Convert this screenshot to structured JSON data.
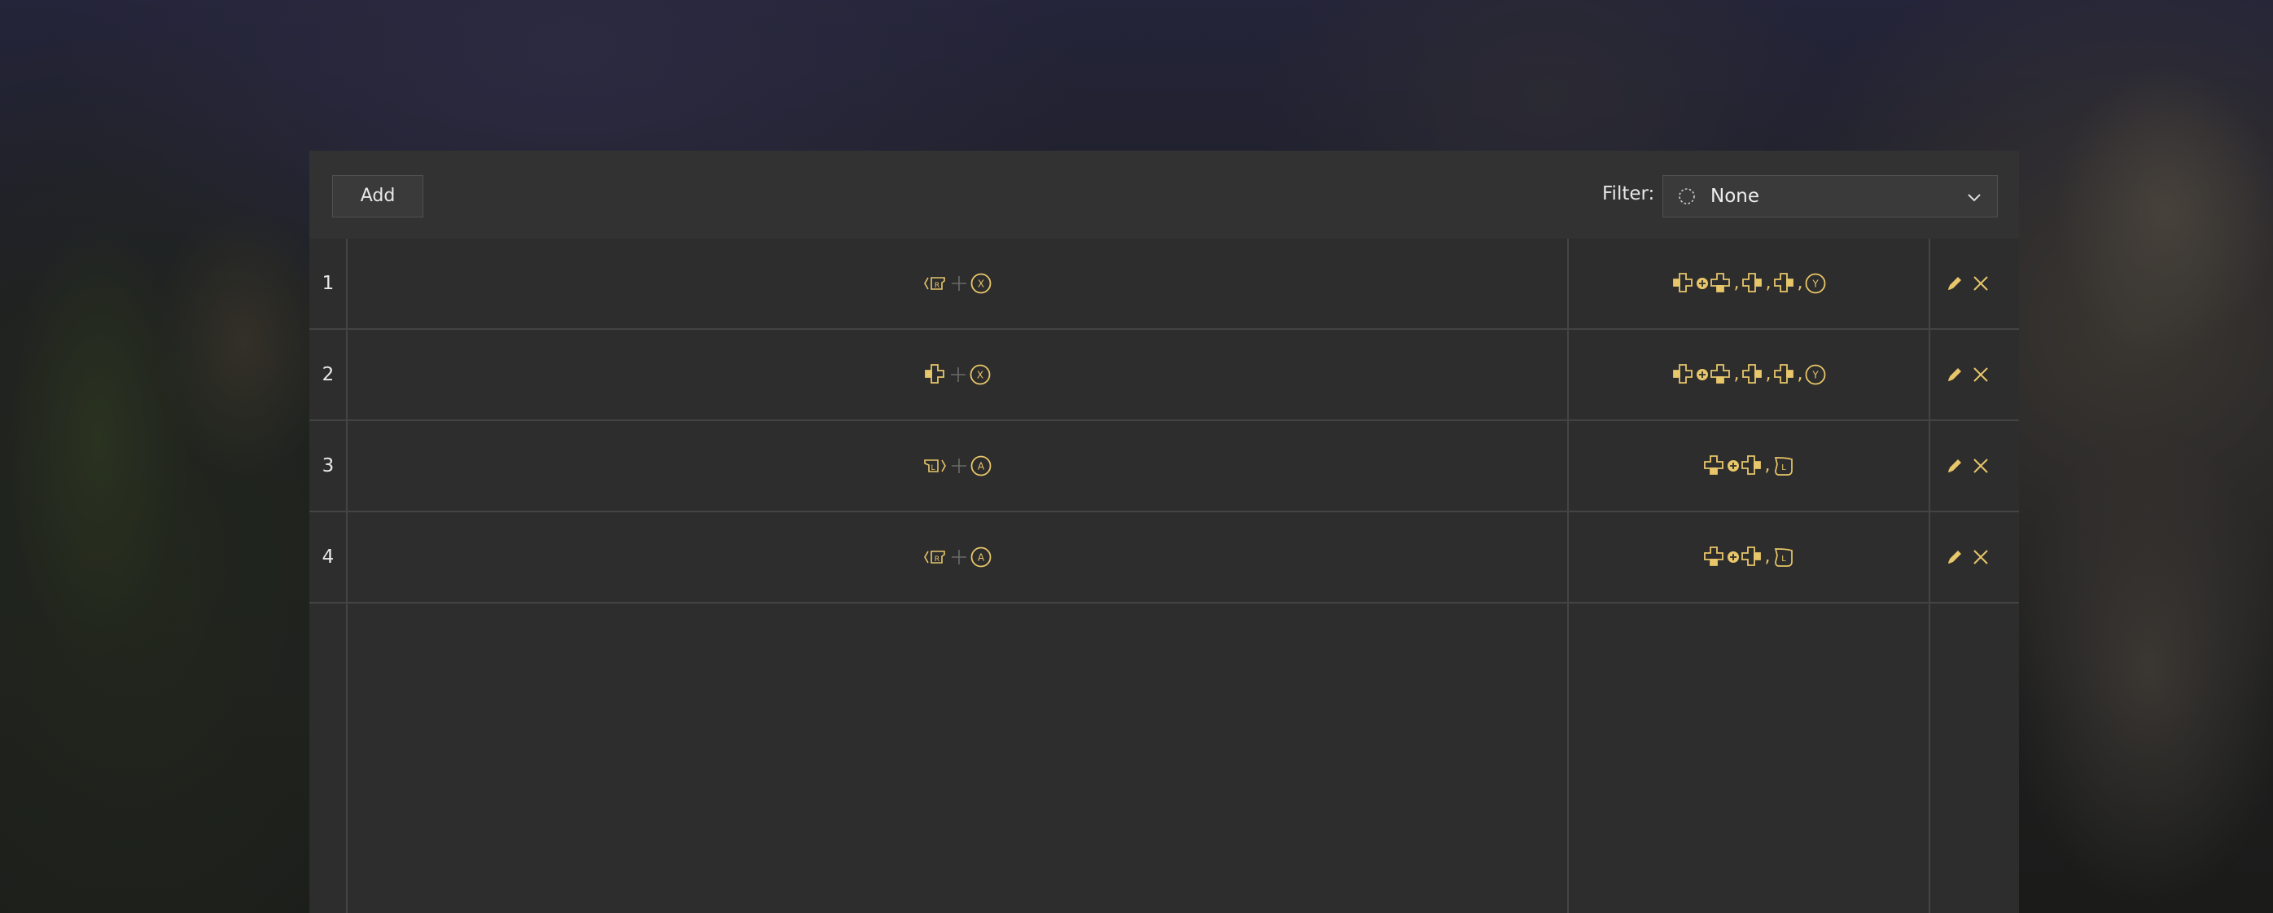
{
  "toolbar": {
    "add_label": "Add",
    "filter_label": "Filter:",
    "filter_value": "None"
  },
  "colors": {
    "accent": "#e8c66a",
    "panel": "#2d2d2d",
    "toolbar": "#323232",
    "grid_line": "#444444"
  },
  "rows": [
    {
      "number": "1",
      "trigger": [
        "rb-button-icon",
        "plus-icon",
        "x-button-icon"
      ],
      "action": [
        "dpad-left-icon",
        "circle-plus-icon",
        "dpad-down-icon",
        "comma",
        "dpad-right-icon",
        "comma",
        "dpad-right-icon",
        "comma",
        "y-button-icon"
      ]
    },
    {
      "number": "2",
      "trigger": [
        "dpad-left-icon",
        "plus-icon",
        "x-button-icon"
      ],
      "action": [
        "dpad-left-icon",
        "circle-plus-icon",
        "dpad-down-icon",
        "comma",
        "dpad-right-icon",
        "comma",
        "dpad-right-icon",
        "comma",
        "y-button-icon"
      ]
    },
    {
      "number": "3",
      "trigger": [
        "lb-button-icon",
        "plus-icon",
        "a-button-icon"
      ],
      "action": [
        "dpad-down-icon",
        "circle-plus-icon",
        "dpad-right-icon",
        "comma",
        "lt-trigger-icon"
      ]
    },
    {
      "number": "4",
      "trigger": [
        "rb-button-icon",
        "plus-icon",
        "a-button-icon"
      ],
      "action": [
        "dpad-down-icon",
        "circle-plus-icon",
        "dpad-right-icon",
        "comma",
        "lt-trigger-icon"
      ]
    }
  ]
}
